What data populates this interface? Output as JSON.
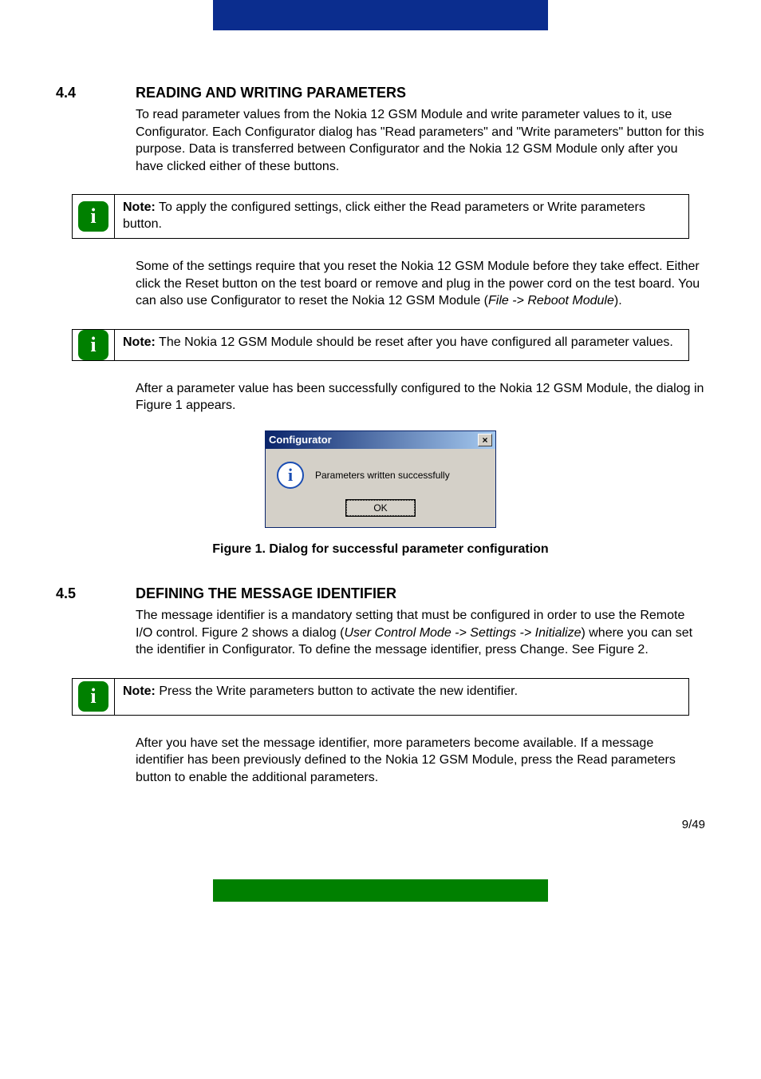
{
  "section44": {
    "num": "4.4",
    "title": "READING AND WRITING PARAMETERS",
    "p1": "To read parameter values from the Nokia 12 GSM Module and write parameter values to it, use Configurator. Each Configurator dialog has \"Read parameters\" and \"Write parameters\" button for this purpose. Data is transferred between Configurator and the Nokia 12 GSM Module only after you have clicked either of these buttons.",
    "note1_label": "Note:",
    "note1": " To apply the configured settings, click either the Read parameters or Write parameters button.",
    "p2a": "Some of the settings require that you reset the Nokia 12 GSM Module before they take effect. Either click the Reset button on the test board or remove and plug in the power cord on the test board. You can also use Configurator to reset the Nokia 12 GSM Module (",
    "p2_italic": "File -> Reboot Module",
    "p2b": ").",
    "note2_label": "Note:",
    "note2": " The Nokia 12 GSM Module should be reset after you have configured all parameter values.",
    "p3": "After a parameter value has been successfully configured to the Nokia 12 GSM Module, the dialog in Figure 1 appears.",
    "dialog": {
      "title": "Configurator",
      "close": "×",
      "message": "Parameters written successfully",
      "ok": "OK"
    },
    "figure_caption": "Figure 1. Dialog for successful parameter configuration"
  },
  "section45": {
    "num": "4.5",
    "title": "DEFINING THE MESSAGE IDENTIFIER",
    "p1a": "The message identifier is a mandatory setting that must be configured in order to use the Remote I/O control. Figure 2 shows a dialog (",
    "p1_italic": "User Control Mode -> Settings -> Initialize",
    "p1b": ") where you can set the identifier in Configurator. To define the message identifier, press Change. See Figure 2.",
    "note_label": "Note:",
    "note": " Press the Write parameters button to activate the new identifier.",
    "p2": "After you have set the message identifier, more parameters become available. If a message identifier has been previously defined to the Nokia 12 GSM Module, press the Read parameters button to enable the additional parameters."
  },
  "page_num": "9/49",
  "icons": {
    "info_glyph": "i"
  }
}
